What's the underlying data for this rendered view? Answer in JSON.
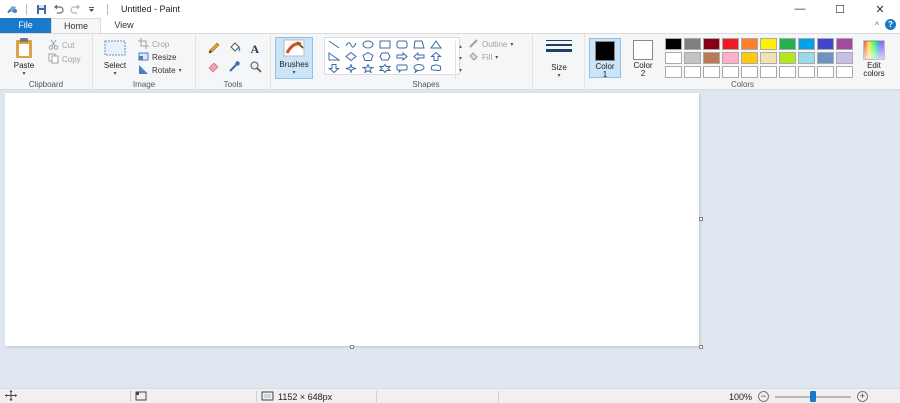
{
  "window": {
    "title": "Untitled - Paint",
    "minimize": "—",
    "maximize": "☐",
    "close": "✕"
  },
  "tabs": {
    "file": "File",
    "home": "Home",
    "view": "View",
    "collapse": "^",
    "help": "?"
  },
  "clipboard": {
    "label": "Clipboard",
    "paste": "Paste",
    "cut": "Cut",
    "copy": "Copy"
  },
  "image": {
    "label": "Image",
    "select": "Select",
    "crop": "Crop",
    "resize": "Resize",
    "rotate": "Rotate"
  },
  "tools": {
    "label": "Tools"
  },
  "brushes": {
    "label": "Brushes"
  },
  "shapes": {
    "label": "Shapes",
    "outline": "Outline",
    "fill": "Fill"
  },
  "size": {
    "label": "Size"
  },
  "colors": {
    "label": "Colors",
    "color1_line1": "Color",
    "color1_line2": "1",
    "color2_line1": "Color",
    "color2_line2": "2",
    "edit_line1": "Edit",
    "edit_line2": "colors",
    "color1": "#000000",
    "color2": "#ffffff",
    "palette": [
      "#000000",
      "#7f7f7f",
      "#880015",
      "#ed1c24",
      "#ff7f27",
      "#fff200",
      "#22b14c",
      "#00a2e8",
      "#3f48cc",
      "#a349a4",
      "#ffffff",
      "#c3c3c3",
      "#b97a57",
      "#ffaec9",
      "#ffc90e",
      "#efe4b0",
      "#b5e61d",
      "#99d9ea",
      "#7092be",
      "#c8bfe7",
      "#ffffff",
      "#ffffff",
      "#ffffff",
      "#ffffff",
      "#ffffff",
      "#ffffff",
      "#ffffff",
      "#ffffff",
      "#ffffff",
      "#ffffff"
    ]
  },
  "status": {
    "dimensions": "1152 × 648px",
    "zoom": "100%"
  }
}
